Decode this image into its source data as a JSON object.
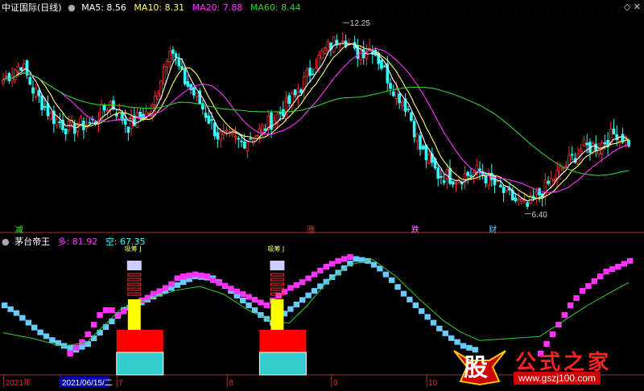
{
  "header": {
    "title": "中证国际(日线)",
    "ma_legend": [
      {
        "label": "MA5: 8.56",
        "color": "#ffffff"
      },
      {
        "label": "MA10: 8.31",
        "color": "#ffff66"
      },
      {
        "label": "MA20: 7.88",
        "color": "#ff33ff"
      },
      {
        "label": "MA60: 8.44",
        "color": "#33cc33"
      }
    ]
  },
  "indicator_header": {
    "title": "茅台帝王",
    "bull_label": "多: 81.92",
    "bear_label": "空: 67.35"
  },
  "watermark": {
    "main": "公式之家",
    "logo_char": "股",
    "url": "www.gszj100.com"
  },
  "colors": {
    "up": "#ff3333",
    "down": "#33ffff",
    "ma5": "#ffffff",
    "ma10": "#ffff66",
    "ma20": "#ff33ff",
    "ma60": "#33cc33",
    "bull_step": "#ff33ff",
    "bear_step": "#66ccff",
    "signal_line": "#33cc33"
  },
  "chart_data": {
    "type": "candlestick",
    "price_annotations": [
      {
        "label": "12.25",
        "value": 12.25,
        "bar": 114
      },
      {
        "label": "6.40",
        "value": 6.4,
        "bar": 175
      }
    ],
    "signal_labels": [
      {
        "text": "减",
        "bar": 4,
        "color": "#33ff33"
      },
      {
        "text": "涨",
        "bar": 102,
        "color": "#ff3333"
      },
      {
        "text": "跌",
        "bar": 137,
        "color": "#ff66ff"
      },
      {
        "text": "财",
        "bar": 163,
        "color": "#66ccff"
      }
    ],
    "box_signals": [
      {
        "bar": 44,
        "caption": "吸筹",
        "mark": "J"
      },
      {
        "bar": 92,
        "caption": "吸筹",
        "mark": "J"
      }
    ],
    "x_axis": [
      {
        "label": "2021年",
        "bar": 1
      },
      {
        "label": "2021/06/15/二",
        "bar": 20,
        "highlight": true
      },
      {
        "label": "7",
        "bar": 39
      },
      {
        "label": "8",
        "bar": 76
      },
      {
        "label": "9",
        "bar": 111
      },
      {
        "label": "10",
        "bar": 143
      }
    ],
    "anchors": [
      [
        0,
        10.5
      ],
      [
        6,
        11.0
      ],
      [
        10,
        10.2
      ],
      [
        16,
        9.4
      ],
      [
        22,
        9.0
      ],
      [
        30,
        9.2
      ],
      [
        36,
        9.8
      ],
      [
        42,
        9.1
      ],
      [
        50,
        9.6
      ],
      [
        56,
        11.6
      ],
      [
        60,
        10.6
      ],
      [
        66,
        9.8
      ],
      [
        72,
        8.8
      ],
      [
        80,
        8.6
      ],
      [
        86,
        8.9
      ],
      [
        92,
        9.4
      ],
      [
        98,
        10.0
      ],
      [
        104,
        10.9
      ],
      [
        108,
        11.4
      ],
      [
        114,
        11.9
      ],
      [
        118,
        11.3
      ],
      [
        124,
        11.5
      ],
      [
        130,
        10.4
      ],
      [
        136,
        9.6
      ],
      [
        140,
        8.4
      ],
      [
        146,
        7.6
      ],
      [
        152,
        7.5
      ],
      [
        160,
        7.7
      ],
      [
        166,
        7.2
      ],
      [
        172,
        6.8
      ],
      [
        176,
        6.6
      ],
      [
        182,
        7.2
      ],
      [
        188,
        7.8
      ],
      [
        194,
        8.4
      ],
      [
        200,
        8.5
      ],
      [
        206,
        8.9
      ],
      [
        210,
        8.6
      ]
    ],
    "price_range": [
      6.0,
      12.6
    ],
    "bull_step_points": [
      [
        22,
        0
      ],
      [
        24,
        0.06
      ],
      [
        26,
        0.12
      ],
      [
        28,
        0.2
      ],
      [
        30,
        0.3
      ],
      [
        32,
        0.4
      ],
      [
        34,
        0.45
      ],
      [
        36,
        0.45
      ],
      [
        38,
        0.4
      ],
      [
        46,
        0.55
      ],
      [
        48,
        0.58
      ],
      [
        50,
        0.62
      ],
      [
        53,
        0.66
      ],
      [
        56,
        0.72
      ],
      [
        58,
        0.78
      ],
      [
        60,
        0.8
      ],
      [
        64,
        0.82
      ],
      [
        68,
        0.8
      ],
      [
        70,
        0.76
      ],
      [
        88,
        0.5
      ],
      [
        92,
        0.6
      ],
      [
        96,
        0.68
      ],
      [
        100,
        0.74
      ],
      [
        104,
        0.82
      ],
      [
        108,
        0.9
      ],
      [
        112,
        0.96
      ],
      [
        116,
        1.0
      ]
    ],
    "bear_step_points": [
      [
        0,
        0.5
      ],
      [
        4,
        0.42
      ],
      [
        8,
        0.32
      ],
      [
        12,
        0.22
      ],
      [
        16,
        0.14
      ],
      [
        20,
        0.08
      ],
      [
        24,
        0.04
      ],
      [
        28,
        0.1
      ],
      [
        40,
        0.45
      ],
      [
        44,
        0.5
      ],
      [
        64,
        0.8
      ],
      [
        70,
        0.78
      ],
      [
        74,
        0.7
      ],
      [
        78,
        0.6
      ],
      [
        82,
        0.5
      ],
      [
        86,
        0.4
      ],
      [
        90,
        0.32
      ],
      [
        118,
        0.98
      ],
      [
        122,
        0.96
      ],
      [
        126,
        0.88
      ],
      [
        130,
        0.76
      ],
      [
        134,
        0.62
      ],
      [
        138,
        0.5
      ],
      [
        142,
        0.38
      ],
      [
        146,
        0.26
      ],
      [
        150,
        0.16
      ],
      [
        154,
        0.08
      ],
      [
        158,
        0.04
      ]
    ],
    "bull_step_points_2": [
      [
        180,
        0
      ],
      [
        182,
        0.1
      ],
      [
        186,
        0.3
      ],
      [
        190,
        0.5
      ],
      [
        194,
        0.65
      ],
      [
        198,
        0.75
      ],
      [
        202,
        0.85
      ],
      [
        206,
        0.9
      ],
      [
        210,
        0.96
      ]
    ],
    "signal_line_points": [
      [
        0,
        0.22
      ],
      [
        10,
        0.16
      ],
      [
        20,
        0.08
      ],
      [
        28,
        0.12
      ],
      [
        34,
        0.3
      ],
      [
        40,
        0.48
      ],
      [
        48,
        0.56
      ],
      [
        58,
        0.66
      ],
      [
        66,
        0.7
      ],
      [
        74,
        0.62
      ],
      [
        82,
        0.46
      ],
      [
        90,
        0.34
      ],
      [
        96,
        0.32
      ],
      [
        102,
        0.5
      ],
      [
        108,
        0.72
      ],
      [
        116,
        0.92
      ],
      [
        124,
        0.98
      ],
      [
        132,
        0.8
      ],
      [
        140,
        0.56
      ],
      [
        148,
        0.34
      ],
      [
        154,
        0.22
      ],
      [
        160,
        0.14
      ],
      [
        180,
        0.18
      ],
      [
        188,
        0.34
      ],
      [
        196,
        0.5
      ],
      [
        204,
        0.64
      ],
      [
        210,
        0.74
      ]
    ]
  }
}
